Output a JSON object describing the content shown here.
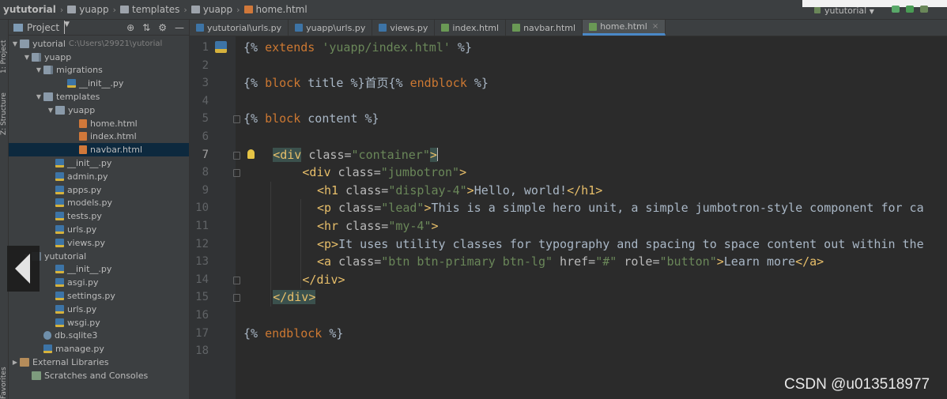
{
  "breadcrumb": [
    "yututorial",
    "yuapp",
    "templates",
    "yuapp",
    "home.html"
  ],
  "run_config": "yututorial",
  "left_strip": {
    "project": "1: Project",
    "structure": "Z: Structure",
    "favorites": "Favorites"
  },
  "project_panel": {
    "title": "Project"
  },
  "tree": [
    {
      "label": "yutorial",
      "path": "C:\\Users\\29921\\yutorial",
      "type": "folder",
      "depth": 0,
      "expanded": true
    },
    {
      "label": "yuapp",
      "type": "pkg",
      "depth": 1,
      "expanded": true
    },
    {
      "label": "migrations",
      "type": "pkg",
      "depth": 2,
      "expanded": true
    },
    {
      "label": "__init__.py",
      "type": "py",
      "depth": 4
    },
    {
      "label": "templates",
      "type": "folder",
      "depth": 2,
      "expanded": true
    },
    {
      "label": "yuapp",
      "type": "folder",
      "depth": 3,
      "expanded": true
    },
    {
      "label": "home.html",
      "type": "html",
      "depth": 5
    },
    {
      "label": "index.html",
      "type": "html",
      "depth": 5
    },
    {
      "label": "navbar.html",
      "type": "html",
      "depth": 5,
      "selected": true
    },
    {
      "label": "__init__.py",
      "type": "py",
      "depth": 3
    },
    {
      "label": "admin.py",
      "type": "py",
      "depth": 3
    },
    {
      "label": "apps.py",
      "type": "py",
      "depth": 3
    },
    {
      "label": "models.py",
      "type": "py",
      "depth": 3
    },
    {
      "label": "tests.py",
      "type": "py",
      "depth": 3
    },
    {
      "label": "urls.py",
      "type": "py",
      "depth": 3
    },
    {
      "label": "views.py",
      "type": "py",
      "depth": 3
    },
    {
      "label": "yututorial",
      "type": "pkg",
      "depth": 1,
      "expanded": true
    },
    {
      "label": "__init__.py",
      "type": "py",
      "depth": 3
    },
    {
      "label": "asgi.py",
      "type": "py",
      "depth": 3
    },
    {
      "label": "settings.py",
      "type": "py",
      "depth": 3
    },
    {
      "label": "urls.py",
      "type": "py",
      "depth": 3
    },
    {
      "label": "wsgi.py",
      "type": "py",
      "depth": 3
    },
    {
      "label": "db.sqlite3",
      "type": "db",
      "depth": 2
    },
    {
      "label": "manage.py",
      "type": "py",
      "depth": 2
    },
    {
      "label": "External Libraries",
      "type": "lib",
      "depth": 0,
      "collapsed": true
    },
    {
      "label": "Scratches and Consoles",
      "type": "scr",
      "depth": 1
    }
  ],
  "tabs": [
    {
      "label": "yututorial\\urls.py",
      "type": "py"
    },
    {
      "label": "yuapp\\urls.py",
      "type": "py"
    },
    {
      "label": "views.py",
      "type": "py"
    },
    {
      "label": "index.html",
      "type": "html"
    },
    {
      "label": "navbar.html",
      "type": "html"
    },
    {
      "label": "home.html",
      "type": "html",
      "active": true
    }
  ],
  "code_lines": [
    {
      "n": "1",
      "indent": 0,
      "tokens": [
        [
          "{% ",
          "n"
        ],
        [
          "extends",
          "kw"
        ],
        [
          " ",
          "n"
        ],
        [
          "'yuapp/index.html'",
          "str"
        ],
        [
          " %}",
          "n"
        ]
      ]
    },
    {
      "n": "2",
      "indent": 0,
      "tokens": []
    },
    {
      "n": "3",
      "indent": 0,
      "tokens": [
        [
          "{% ",
          "n"
        ],
        [
          "block",
          "kw"
        ],
        [
          " title %}首页{% ",
          "n"
        ],
        [
          "endblock",
          "kw"
        ],
        [
          " %}",
          "n"
        ]
      ]
    },
    {
      "n": "4",
      "indent": 0,
      "tokens": []
    },
    {
      "n": "5",
      "indent": 0,
      "tokens": [
        [
          "{% ",
          "n"
        ],
        [
          "block",
          "kw"
        ],
        [
          " content %}",
          "n"
        ]
      ]
    },
    {
      "n": "6",
      "indent": 0,
      "tokens": []
    },
    {
      "n": "7",
      "indent": 4,
      "tokens": [
        [
          "<div",
          "tg-hl"
        ],
        [
          " class=",
          "at"
        ],
        [
          "\"container\"",
          "str"
        ],
        [
          ">",
          "tg-hl"
        ],
        [
          "",
          "caret"
        ]
      ]
    },
    {
      "n": "8",
      "indent": 8,
      "tokens": [
        [
          "<div",
          "tg"
        ],
        [
          " class=",
          "at"
        ],
        [
          "\"jumbotron\"",
          "str"
        ],
        [
          ">",
          "tg"
        ]
      ]
    },
    {
      "n": "9",
      "indent": 10,
      "tokens": [
        [
          "<h1",
          "tg"
        ],
        [
          " class=",
          "at"
        ],
        [
          "\"display-4\"",
          "str"
        ],
        [
          ">",
          "tg"
        ],
        [
          "Hello, world!",
          "n"
        ],
        [
          "</h1>",
          "tg"
        ]
      ]
    },
    {
      "n": "10",
      "indent": 10,
      "tokens": [
        [
          "<p",
          "tg"
        ],
        [
          " class=",
          "at"
        ],
        [
          "\"lead\"",
          "str"
        ],
        [
          ">",
          "tg"
        ],
        [
          "This is a simple hero unit, a simple jumbotron-style component for ca",
          "n"
        ]
      ]
    },
    {
      "n": "11",
      "indent": 10,
      "tokens": [
        [
          "<hr",
          "tg"
        ],
        [
          " class=",
          "at"
        ],
        [
          "\"my-4\"",
          "str"
        ],
        [
          ">",
          "tg"
        ]
      ]
    },
    {
      "n": "12",
      "indent": 10,
      "tokens": [
        [
          "<p>",
          "tg"
        ],
        [
          "It uses utility classes for typography and spacing to space content out within the",
          "n"
        ]
      ]
    },
    {
      "n": "13",
      "indent": 10,
      "tokens": [
        [
          "<a",
          "tg"
        ],
        [
          " class=",
          "at"
        ],
        [
          "\"btn btn-primary btn-lg\"",
          "str"
        ],
        [
          " href=",
          "at"
        ],
        [
          "\"#\"",
          "str"
        ],
        [
          " role=",
          "at"
        ],
        [
          "\"button\"",
          "str"
        ],
        [
          ">",
          "tg"
        ],
        [
          "Learn more",
          "n"
        ],
        [
          "</a>",
          "tg"
        ]
      ]
    },
    {
      "n": "14",
      "indent": 8,
      "tokens": [
        [
          "</div>",
          "tg"
        ]
      ]
    },
    {
      "n": "15",
      "indent": 4,
      "tokens": [
        [
          "</div>",
          "tg-hl"
        ]
      ]
    },
    {
      "n": "16",
      "indent": 0,
      "tokens": []
    },
    {
      "n": "17",
      "indent": 0,
      "tokens": [
        [
          "{% ",
          "n"
        ],
        [
          "endblock",
          "kw"
        ],
        [
          " %}",
          "n"
        ]
      ]
    },
    {
      "n": "18",
      "indent": 0,
      "tokens": []
    }
  ],
  "current_line": "7",
  "watermark": "CSDN @u013518977",
  "colors": {
    "keyword": "#cc7832",
    "string": "#6a8759",
    "tag": "#e8bf6a",
    "attr": "#bababa",
    "text": "#a9b7c6",
    "bg": "#2b2b2b",
    "panel": "#3c3f41",
    "selection": "#0d293e"
  }
}
